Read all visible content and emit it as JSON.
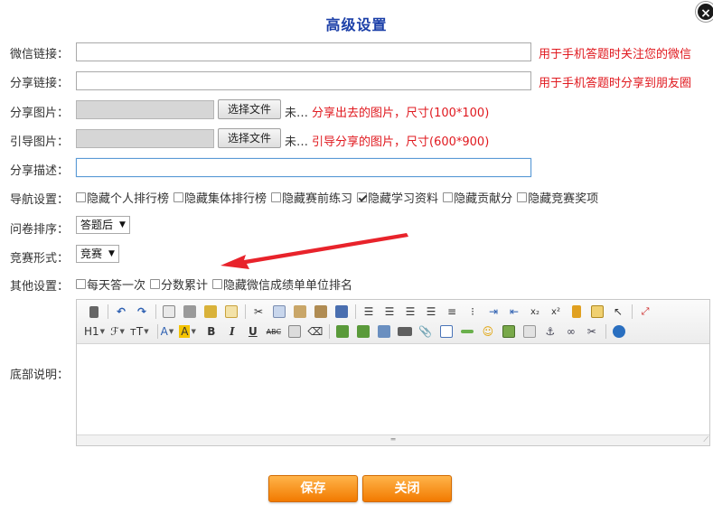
{
  "dialog": {
    "title": "高级设置",
    "close_label": "×"
  },
  "fields": {
    "wechat_link": {
      "label": "微信链接：",
      "value": "",
      "hint": "用于手机答题时关注您的微信"
    },
    "share_link": {
      "label": "分享链接：",
      "value": "",
      "hint": "用于手机答题时分享到朋友圈"
    },
    "share_image": {
      "label": "分享图片：",
      "button": "选择文件",
      "status": "未…",
      "hint": "分享出去的图片，尺寸(100*100)"
    },
    "guide_image": {
      "label": "引导图片：",
      "button": "选择文件",
      "status": "未…",
      "hint": "引导分享的图片，尺寸(600*900)"
    },
    "share_desc": {
      "label": "分享描述：",
      "value": ""
    },
    "nav_settings": {
      "label": "导航设置：",
      "options": [
        {
          "label": "隐藏个人排行榜",
          "checked": false
        },
        {
          "label": "隐藏集体排行榜",
          "checked": false
        },
        {
          "label": "隐藏赛前练习",
          "checked": false
        },
        {
          "label": "隐藏学习资料",
          "checked": true
        },
        {
          "label": "隐藏贡献分",
          "checked": false
        },
        {
          "label": "隐藏竞赛奖项",
          "checked": false
        }
      ]
    },
    "question_order": {
      "label": "问卷排序：",
      "selected": "答题后"
    },
    "contest_type": {
      "label": "竞赛形式：",
      "selected": "竞赛"
    },
    "other_settings": {
      "label": "其他设置：",
      "options": [
        {
          "label": "每天答一次",
          "checked": false
        },
        {
          "label": "分数累计",
          "checked": false
        },
        {
          "label": "隐藏微信成绩单单位排名",
          "checked": false
        }
      ]
    },
    "footer_desc": {
      "label": "底部说明："
    }
  },
  "editor": {
    "row1": [
      "source-icon",
      "undo-icon",
      "redo-icon",
      "preview-icon",
      "print-icon",
      "template-icon",
      "code-icon",
      "cut-icon",
      "copy-icon",
      "paste-icon",
      "paste-text-icon",
      "paste-word-icon",
      "align-left-icon",
      "align-center-icon",
      "align-right-icon",
      "align-justify-icon",
      "numbered-list-icon",
      "bullet-list-icon",
      "indent-icon",
      "outdent-icon",
      "subscript-icon",
      "superscript-icon",
      "clear-format-icon",
      "select-all-icon",
      "cursor-icon",
      "fullscreen-icon"
    ],
    "row2_drops": {
      "heading": "H1",
      "font": "ℱ",
      "size": "тT"
    },
    "row2_marks": {
      "bold": "B",
      "italic": "I",
      "underline": "U",
      "strike": "ABC"
    }
  },
  "buttons": {
    "save": "保存",
    "close": "关闭"
  },
  "colors": {
    "accent_blue": "#1b3fa8",
    "hint_red": "#e0191f",
    "button_orange": "#f27a00",
    "arrow_red": "#e8232b"
  }
}
